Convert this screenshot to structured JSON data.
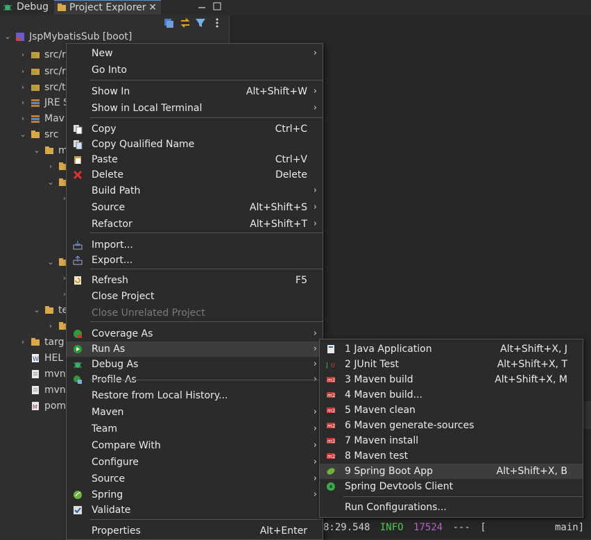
{
  "tabs": {
    "debug": "Debug",
    "project_explorer": "Project Explorer",
    "close": "✕"
  },
  "tree": [
    {
      "label": "JspMybatisSub [boot]",
      "chev": "⌄"
    },
    {
      "label": "src/r",
      "chev": "›"
    },
    {
      "label": "src/r",
      "chev": "›"
    },
    {
      "label": "src/t",
      "chev": "›"
    },
    {
      "label": "JRE S",
      "chev": "›"
    },
    {
      "label": "Mav",
      "chev": "›"
    },
    {
      "label": "src",
      "chev": "⌄"
    },
    {
      "label": "m",
      "chev": "⌄"
    },
    {
      "label": "",
      "chev": "›"
    },
    {
      "label": "",
      "chev": "⌄"
    },
    {
      "label": "",
      "chev": "›"
    },
    {
      "label": "",
      "chev": "⌄"
    },
    {
      "label": "",
      "chev": "›"
    },
    {
      "label": "",
      "chev": "›"
    },
    {
      "label": "te",
      "chev": "⌄"
    },
    {
      "label": "",
      "chev": "›"
    },
    {
      "label": "targ",
      "chev": "›"
    },
    {
      "label": "HEL",
      "chev": ""
    },
    {
      "label": "mvn",
      "chev": ""
    },
    {
      "label": "mvn",
      "chev": ""
    },
    {
      "label": "pom",
      "chev": ""
    }
  ],
  "context_menu": {
    "items": [
      {
        "label": "New",
        "accel": "",
        "submenu": true
      },
      {
        "label": "Go Into",
        "accel": ""
      },
      {
        "label": "Show In",
        "accel": "Alt+Shift+W",
        "submenu": true
      },
      {
        "label": "Show in Local Terminal",
        "accel": "",
        "submenu": true
      },
      {
        "label": "Copy",
        "accel": "Ctrl+C"
      },
      {
        "label": "Copy Qualified Name",
        "accel": ""
      },
      {
        "label": "Paste",
        "accel": "Ctrl+V"
      },
      {
        "label": "Delete",
        "accel": "Delete"
      },
      {
        "label": "Build Path",
        "accel": "",
        "submenu": true
      },
      {
        "label": "Source",
        "accel": "Alt+Shift+S",
        "submenu": true
      },
      {
        "label": "Refactor",
        "accel": "Alt+Shift+T",
        "submenu": true
      },
      {
        "label": "Import...",
        "accel": ""
      },
      {
        "label": "Export...",
        "accel": ""
      },
      {
        "label": "Refresh",
        "accel": "F5"
      },
      {
        "label": "Close Project",
        "accel": ""
      },
      {
        "label": "Close Unrelated Project",
        "accel": "",
        "disabled": true
      },
      {
        "label": "Coverage As",
        "accel": "",
        "submenu": true
      },
      {
        "label": "Run As",
        "accel": "",
        "submenu": true,
        "highlighted": true
      },
      {
        "label": "Debug As",
        "accel": "",
        "submenu": true
      },
      {
        "label": "Profile As",
        "accel": "",
        "submenu": true
      },
      {
        "label": "Restore from Local History...",
        "accel": ""
      },
      {
        "label": "Maven",
        "accel": "",
        "submenu": true
      },
      {
        "label": "Team",
        "accel": "",
        "submenu": true
      },
      {
        "label": "Compare With",
        "accel": "",
        "submenu": true
      },
      {
        "label": "Configure",
        "accel": "",
        "submenu": true
      },
      {
        "label": "Source",
        "accel": "",
        "submenu": true
      },
      {
        "label": "Spring",
        "accel": "",
        "submenu": true
      },
      {
        "label": "Validate",
        "accel": ""
      },
      {
        "label": "Properties",
        "accel": "Alt+Enter"
      }
    ]
  },
  "run_as_menu": {
    "items": [
      {
        "label": "1 Java Application",
        "accel": "Alt+Shift+X, J"
      },
      {
        "label": "2 JUnit Test",
        "accel": "Alt+Shift+X, T"
      },
      {
        "label": "3 Maven build",
        "accel": "Alt+Shift+X, M"
      },
      {
        "label": "4 Maven build...",
        "accel": ""
      },
      {
        "label": "5 Maven clean",
        "accel": ""
      },
      {
        "label": "6 Maven generate-sources",
        "accel": ""
      },
      {
        "label": "7 Maven install",
        "accel": ""
      },
      {
        "label": "8 Maven test",
        "accel": ""
      },
      {
        "label": "9 Spring Boot App",
        "accel": "Alt+Shift+X, B",
        "highlighted": true
      },
      {
        "label": "Spring Devtools Client",
        "accel": ""
      },
      {
        "label": "Run Configurations...",
        "accel": ""
      }
    ]
  },
  "console": {
    "line1_time": "8:29.548",
    "line1_level": "INFO",
    "line1_pid": "17524",
    "line1_sep": "---",
    "line1_thread": "[",
    "line1_main": "main]"
  },
  "colors": {
    "accent": "#5a8fd6",
    "info_green": "#4fc94f",
    "pid_purple": "#b565c4",
    "menu_bg": "#2b2b2b",
    "highlight": "#3d3d3d"
  }
}
